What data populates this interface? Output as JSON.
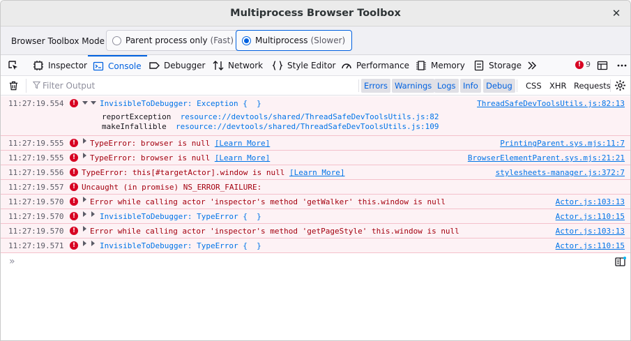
{
  "window": {
    "title": "Multiprocess Browser Toolbox",
    "close_glyph": "✕"
  },
  "mode": {
    "label": "Browser Toolbox Mode",
    "options": [
      {
        "label": "Parent process only",
        "hint": "(Fast)",
        "selected": false
      },
      {
        "label": "Multiprocess",
        "hint": "(Slower)",
        "selected": true
      }
    ]
  },
  "tabs": [
    {
      "label": "Inspector",
      "icon": "inspector-icon"
    },
    {
      "label": "Console",
      "icon": "console-icon",
      "active": true
    },
    {
      "label": "Debugger",
      "icon": "debugger-icon"
    },
    {
      "label": "Network",
      "icon": "network-icon"
    },
    {
      "label": "Style Editor",
      "icon": "style-editor-icon"
    },
    {
      "label": "Performance",
      "icon": "performance-icon"
    },
    {
      "label": "Memory",
      "icon": "memory-icon"
    },
    {
      "label": "Storage",
      "icon": "storage-icon"
    }
  ],
  "error_count": "9",
  "filter": {
    "placeholder": "Filter Output",
    "levels": [
      "Errors",
      "Warnings",
      "Logs",
      "Info",
      "Debug"
    ],
    "extra": [
      "CSS",
      "XHR",
      "Requests"
    ]
  },
  "messages": [
    {
      "time": "11:27:19.554",
      "text": "InvisibleToDebugger: Exception {  }",
      "source": "ThreadSafeDevToolsUtils.js:82:13",
      "stack": [
        {
          "fn": "reportException",
          "loc": "resource://devtools/shared/ThreadSafeDevToolsUtils.js:82"
        },
        {
          "fn": "makeInfallible",
          "loc": "resource://devtools/shared/ThreadSafeDevToolsUtils.js:109"
        }
      ]
    },
    {
      "time": "11:27:19.555",
      "text": "TypeError: browser is null",
      "learn": "[Learn More]",
      "source": "PrintingParent.sys.mjs:11:7"
    },
    {
      "time": "11:27:19.555",
      "text": "TypeError: browser is null",
      "learn": "[Learn More]",
      "source": "BrowserElementParent.sys.mjs:21:21"
    },
    {
      "time": "11:27:19.556",
      "text": "TypeError: this[#targetActor].window is null",
      "learn": "[Learn More]",
      "source": "stylesheets-manager.js:372:7"
    },
    {
      "time": "11:27:19.557",
      "text": "Uncaught (in promise) NS_ERROR_FAILURE:",
      "source": ""
    },
    {
      "time": "11:27:19.570",
      "text": "Error while calling actor 'inspector's method 'getWalker' this.window is null",
      "source": "Actor.js:103:13"
    },
    {
      "time": "11:27:19.570",
      "text": "InvisibleToDebugger: TypeError {  }",
      "source": "Actor.js:110:15"
    },
    {
      "time": "11:27:19.570",
      "text": "Error while calling actor 'inspector's method 'getPageStyle' this.window is null",
      "source": "Actor.js:103:13"
    },
    {
      "time": "11:27:19.571",
      "text": "InvisibleToDebugger: TypeError {  }",
      "source": "Actor.js:110:15"
    }
  ],
  "prompt_glyph": "»"
}
